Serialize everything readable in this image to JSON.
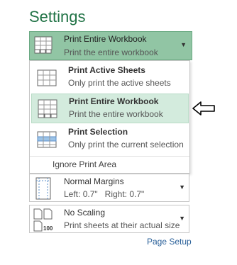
{
  "settings": {
    "title": "Settings"
  },
  "print_what": {
    "selected_title": "Print Entire Workbook",
    "selected_subtitle": "Print the entire workbook",
    "options": [
      {
        "title": "Print Active Sheets",
        "subtitle": "Only print the active sheets",
        "icon": "active-sheets-icon"
      },
      {
        "title": "Print Entire Workbook",
        "subtitle": "Print the entire workbook",
        "icon": "entire-workbook-icon"
      },
      {
        "title": "Print Selection",
        "subtitle": "Only print the current selection",
        "icon": "selection-icon"
      }
    ],
    "ignore_print_area": "Ignore Print Area"
  },
  "margins": {
    "title": "Normal Margins",
    "left_label": "Left:",
    "left_value": "0.7\"",
    "right_label": "Right:",
    "right_value": "0.7\""
  },
  "scaling": {
    "title": "No Scaling",
    "subtitle": "Print sheets at their actual size",
    "icon_text": "100"
  },
  "page_setup": "Page Setup",
  "colors": {
    "accent": "#217346",
    "selected_bg": "#91c5a4",
    "hover_bg": "#d3ebdd",
    "link": "#2a6099"
  }
}
